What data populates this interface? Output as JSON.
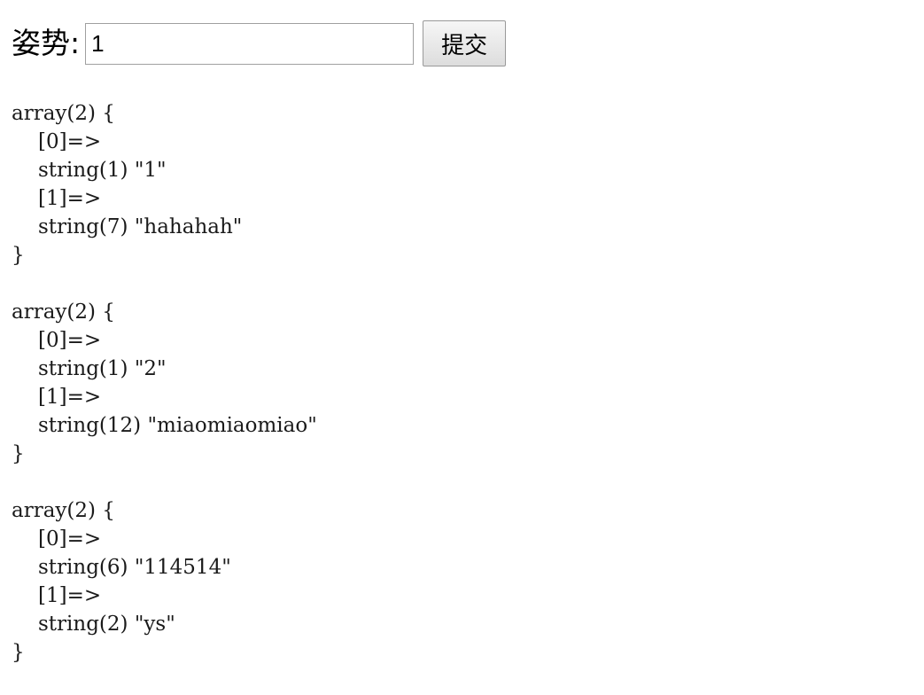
{
  "form": {
    "label": "姿势:",
    "input_value": "1",
    "submit_label": "提交"
  },
  "dumps": [
    {
      "header": "array(2) {",
      "lines": [
        "[0]=>",
        "string(1) \"1\"",
        "[1]=>",
        "string(7) \"hahahah\""
      ],
      "footer": "}"
    },
    {
      "header": "array(2) {",
      "lines": [
        "[0]=>",
        "string(1) \"2\"",
        "[1]=>",
        "string(12) \"miaomiaomiao\""
      ],
      "footer": "}"
    },
    {
      "header": "array(2) {",
      "lines": [
        "[0]=>",
        "string(6) \"114514\"",
        "[1]=>",
        "string(2) \"ys\""
      ],
      "footer": "}"
    }
  ]
}
